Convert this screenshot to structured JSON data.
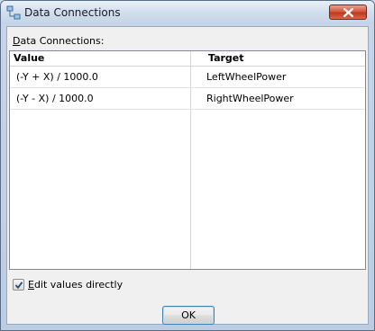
{
  "window": {
    "title": "Data Connections",
    "icons": {
      "app": "data-connections-icon",
      "close": "close-icon"
    }
  },
  "section": {
    "label_accel": "D",
    "label_rest": "ata Connections:"
  },
  "grid": {
    "columns": [
      "Value",
      "Target"
    ],
    "rows": [
      {
        "value": "(-Y + X) / 1000.0",
        "target": "LeftWheelPower"
      },
      {
        "value": "(-Y - X) / 1000.0",
        "target": "RightWheelPower"
      }
    ]
  },
  "options": {
    "edit_directly": {
      "checked": true,
      "label_accel": "E",
      "label_rest": "dit values directly"
    }
  },
  "buttons": {
    "ok": "OK"
  }
}
